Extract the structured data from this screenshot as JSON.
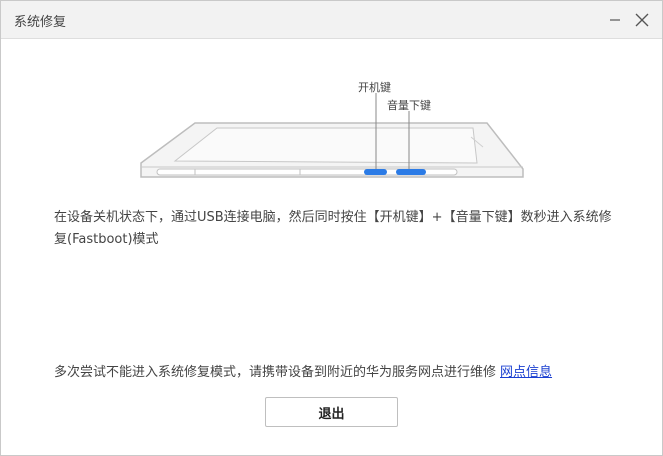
{
  "window": {
    "title": "系统修复"
  },
  "illustration": {
    "power_key_label": "开机键",
    "volume_down_label": "音量下键",
    "highlight_color": "#2b7be6"
  },
  "instruction": "在设备关机状态下，通过USB连接电脑，然后同时按住【开机键】+【音量下键】数秒进入系统修复(Fastboot)模式",
  "footer": {
    "note": "多次尝试不能进入系统修复模式，请携带设备到附近的华为服务网点进行维修",
    "link_label": "网点信息"
  },
  "exit_button": {
    "label": "退出"
  }
}
